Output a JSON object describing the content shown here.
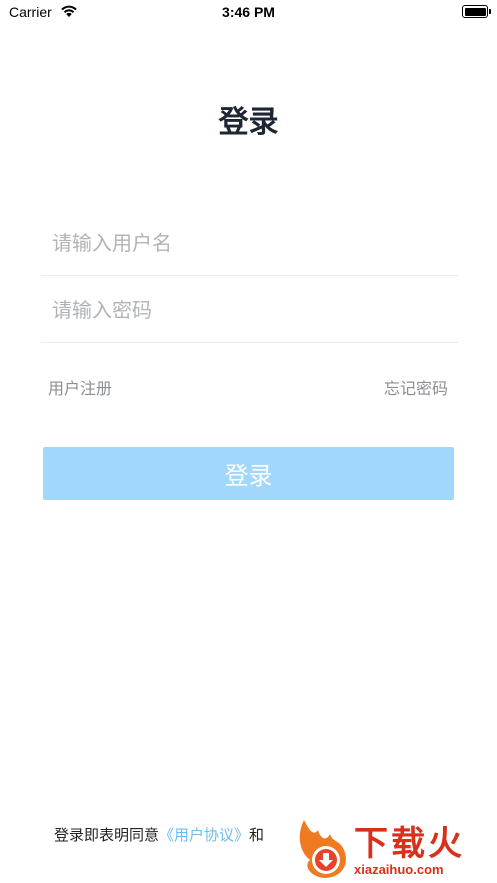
{
  "status_bar": {
    "carrier": "Carrier",
    "time": "3:46 PM",
    "wifi_icon": "wifi-icon",
    "battery_icon": "battery-icon"
  },
  "page": {
    "title": "登录"
  },
  "form": {
    "username_placeholder": "请输入用户名",
    "username_value": "",
    "password_placeholder": "请输入密码",
    "password_value": "",
    "register_label": "用户注册",
    "forgot_label": "忘记密码",
    "login_label": "登录"
  },
  "agreement": {
    "prefix": "登录即表明同意",
    "user_agreement": "《用户协议》",
    "and": "和"
  },
  "watermark": {
    "text": "下载火",
    "sub": "xiazaihuo.com"
  },
  "colors": {
    "title": "#1f2633",
    "button_bg": "#a1d7fb",
    "link_blue": "#6cbcf1",
    "watermark_red": "#d8301a"
  }
}
